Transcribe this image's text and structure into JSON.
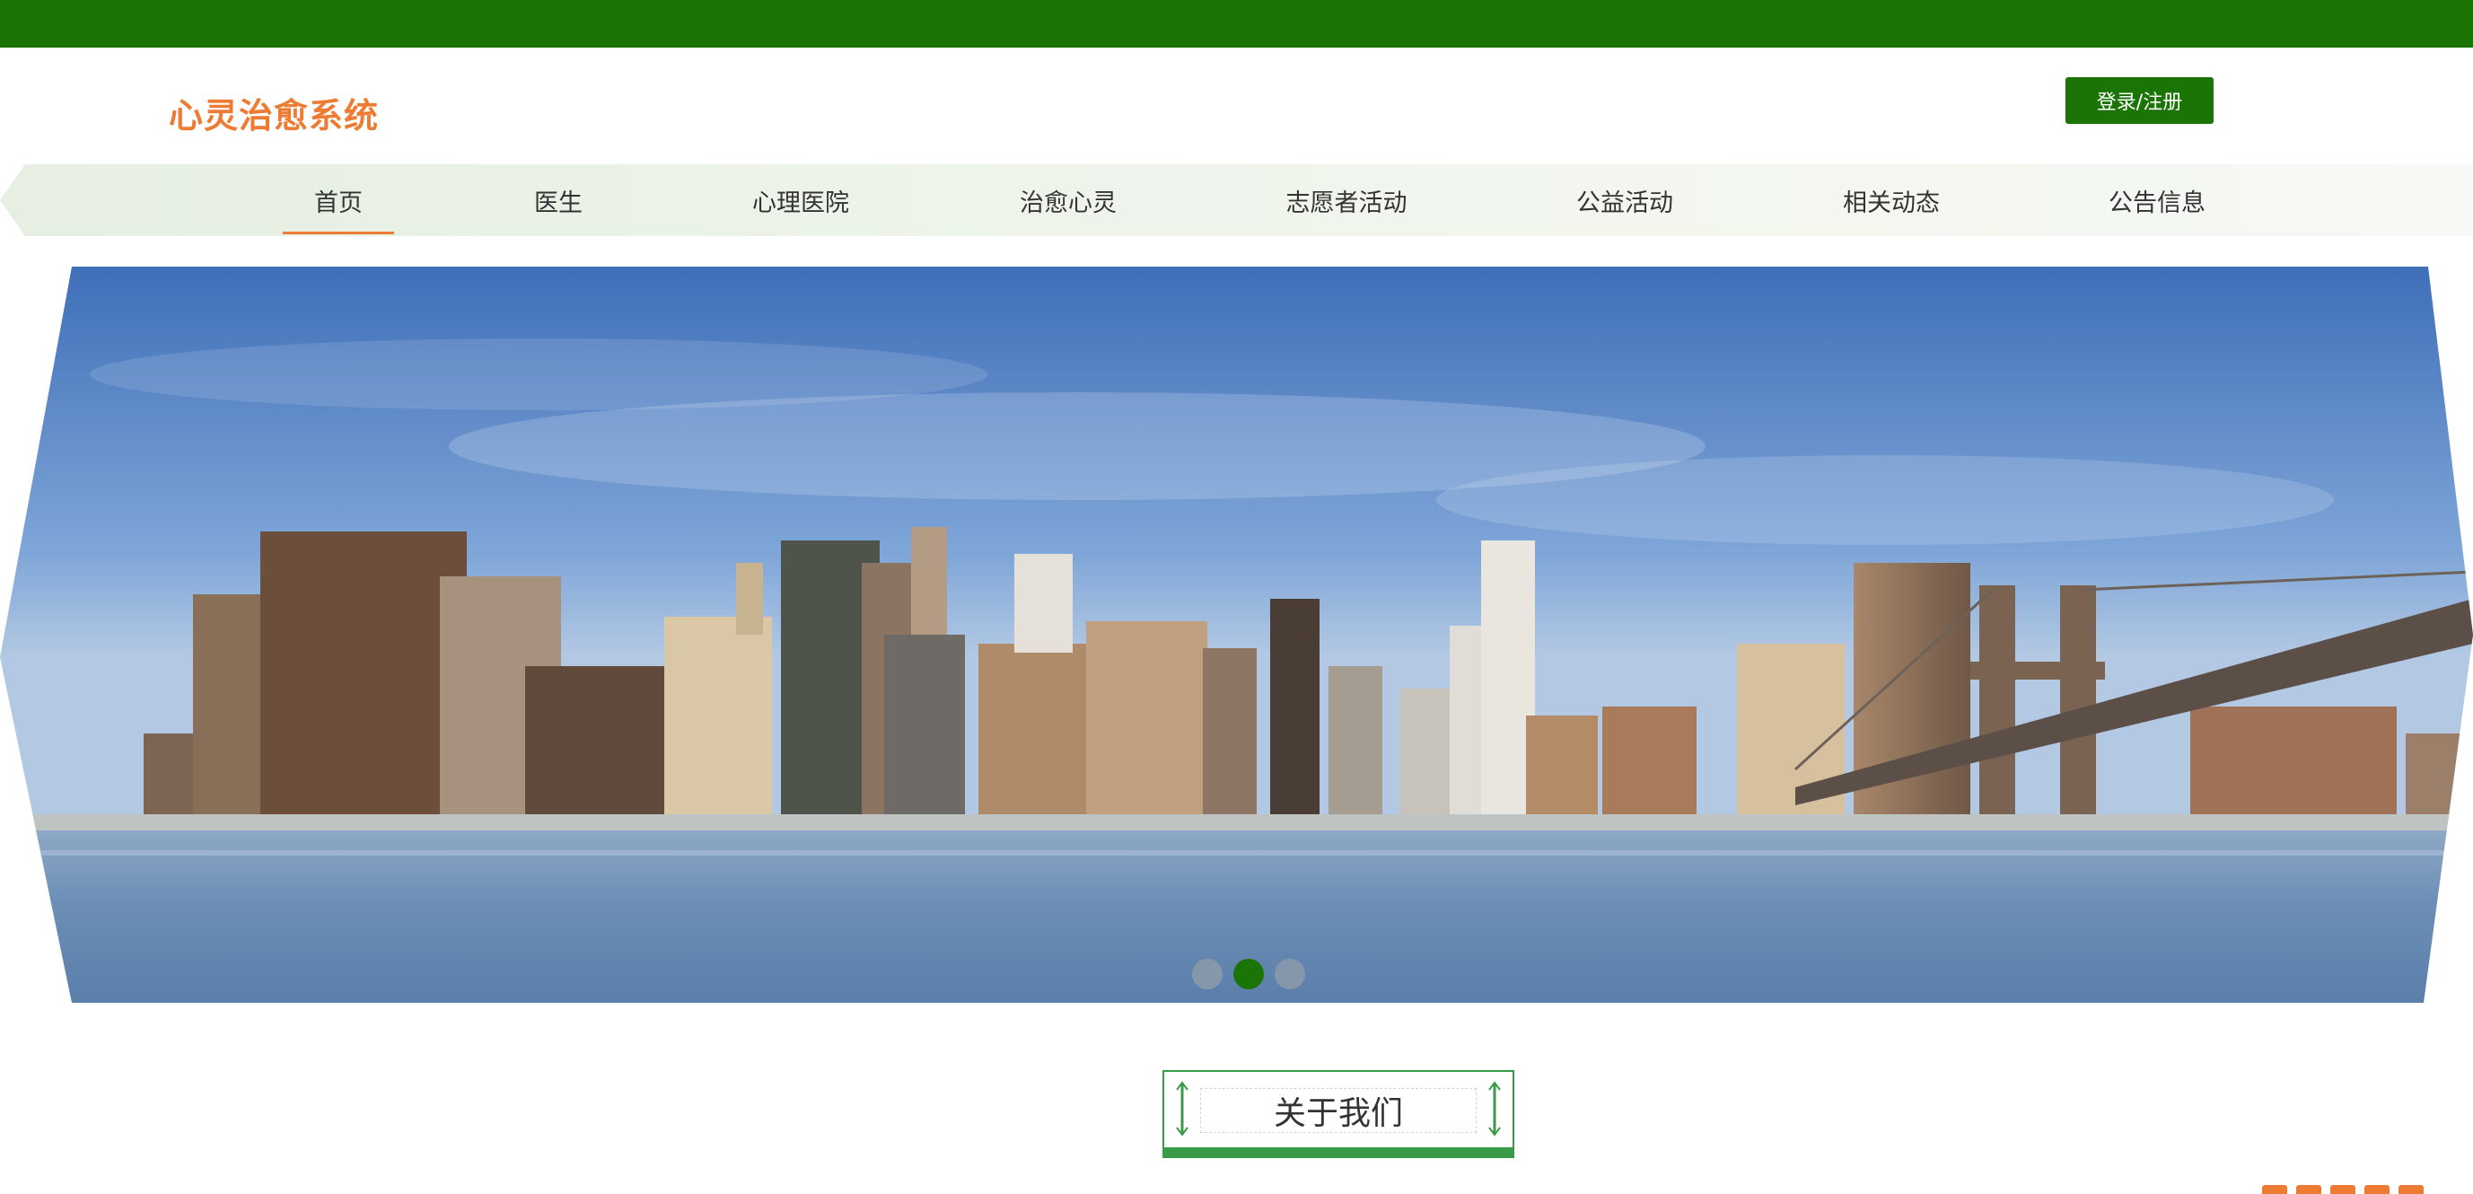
{
  "brand": {
    "title": "心灵治愈系统"
  },
  "header": {
    "login_label": "登录/注册"
  },
  "nav": {
    "items": [
      {
        "label": "首页",
        "active": true
      },
      {
        "label": "医生",
        "active": false
      },
      {
        "label": "心理医院",
        "active": false
      },
      {
        "label": "治愈心灵",
        "active": false
      },
      {
        "label": "志愿者活动",
        "active": false
      },
      {
        "label": "公益活动",
        "active": false
      },
      {
        "label": "相关动态",
        "active": false
      },
      {
        "label": "公告信息",
        "active": false
      }
    ]
  },
  "carousel": {
    "slide_count": 3,
    "active_index": 1
  },
  "about": {
    "title": "关于我们"
  },
  "colors": {
    "primary_green": "#1b7406",
    "accent_orange": "#ee7b33",
    "section_green": "#3b9a4a"
  }
}
